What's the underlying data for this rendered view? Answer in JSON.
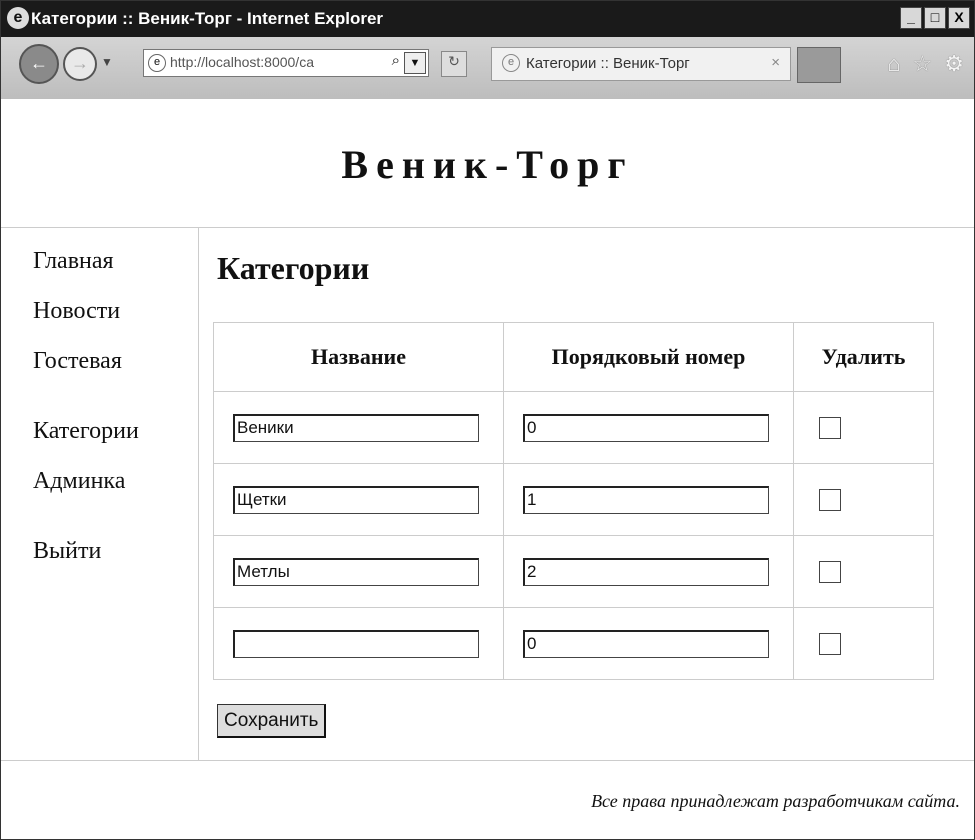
{
  "window": {
    "title": "Категории :: Веник-Торг - Internet Explorer",
    "minimize": "_",
    "maximize": "□",
    "close": "X"
  },
  "browser": {
    "address_url": "http://localhost:8000/ca",
    "tab_title": "Категории :: Веник-Торг",
    "tab_close": "×",
    "search_glyph": "⌕",
    "dropdown_glyph": "▼"
  },
  "site": {
    "title": "Веник-Торг"
  },
  "nav": {
    "items": [
      "Главная",
      "Новости",
      "Гостевая",
      "Категории",
      "Админка",
      "Выйти"
    ]
  },
  "main": {
    "heading": "Категории",
    "columns": [
      "Название",
      "Порядковый номер",
      "Удалить"
    ],
    "rows": [
      {
        "name": "Веники",
        "order": "0",
        "delete": false
      },
      {
        "name": "Щетки",
        "order": "1",
        "delete": false
      },
      {
        "name": "Метлы",
        "order": "2",
        "delete": false
      },
      {
        "name": "",
        "order": "0",
        "delete": false
      }
    ],
    "save_label": "Сохранить"
  },
  "footer": {
    "copyright": "Все права принадлежат разработчикам сайта."
  }
}
